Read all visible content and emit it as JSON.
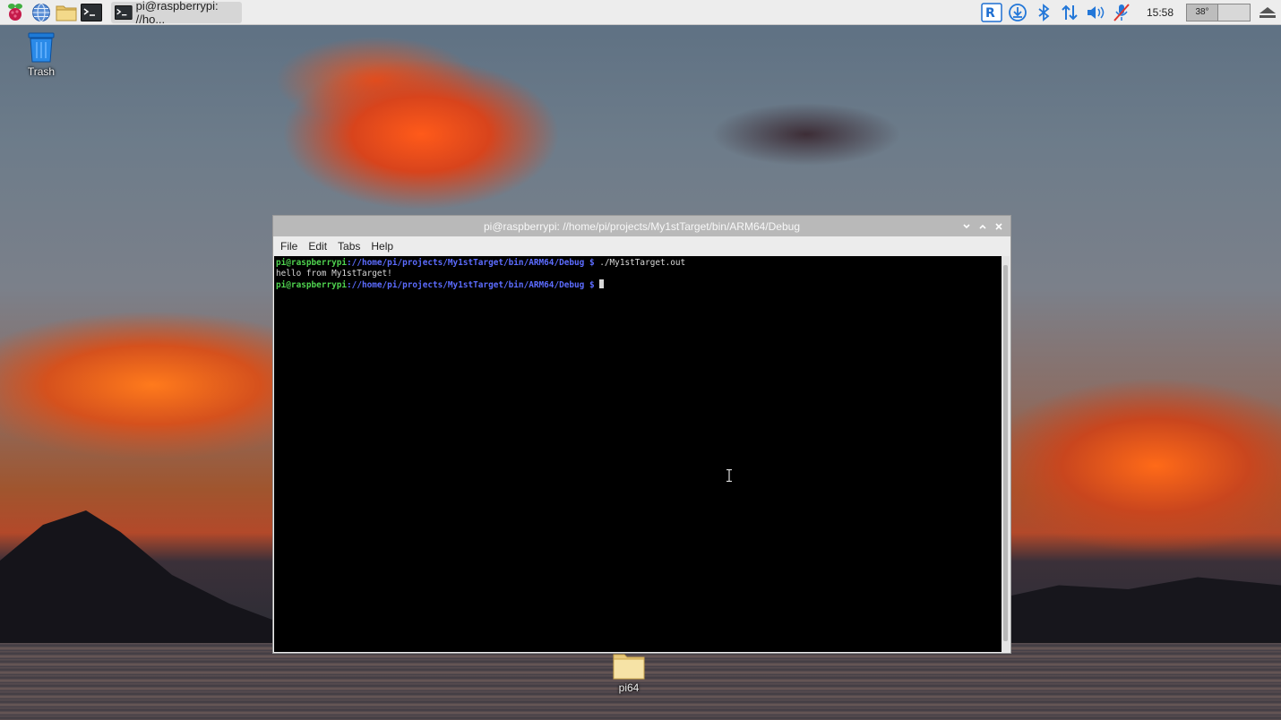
{
  "panel": {
    "launcher_icon": "raspberry-menu-icon",
    "quick_launch": [
      {
        "name": "web-browser-icon"
      },
      {
        "name": "file-manager-icon"
      },
      {
        "name": "terminal-icon"
      }
    ],
    "task": {
      "label": "pi@raspberrypi: //ho...",
      "icon": "terminal-icon"
    },
    "tray": {
      "icons": [
        "vnc-icon",
        "updates-icon",
        "bluetooth-icon",
        "network-icon",
        "volume-icon",
        "microphone-muted-icon"
      ],
      "clock": "15:58",
      "cpu_temp": "38°",
      "eject_icon": "eject-icon"
    }
  },
  "desktop": {
    "trash_label": "Trash",
    "folder_label": "pi64"
  },
  "window": {
    "title": "pi@raspberrypi: //home/pi/projects/My1stTarget/bin/ARM64/Debug",
    "menu": [
      "File",
      "Edit",
      "Tabs",
      "Help"
    ],
    "terminal": {
      "prompt_user": "pi@raspberrypi",
      "prompt_path": "://home/pi/projects/My1stTarget/bin/ARM64/Debug $",
      "command": " ./My1stTarget.out",
      "output": "hello from My1stTarget!"
    }
  },
  "colors": {
    "prompt_user": "#4fd34f",
    "prompt_path": "#5c6cff",
    "terminal_bg": "#000000"
  }
}
